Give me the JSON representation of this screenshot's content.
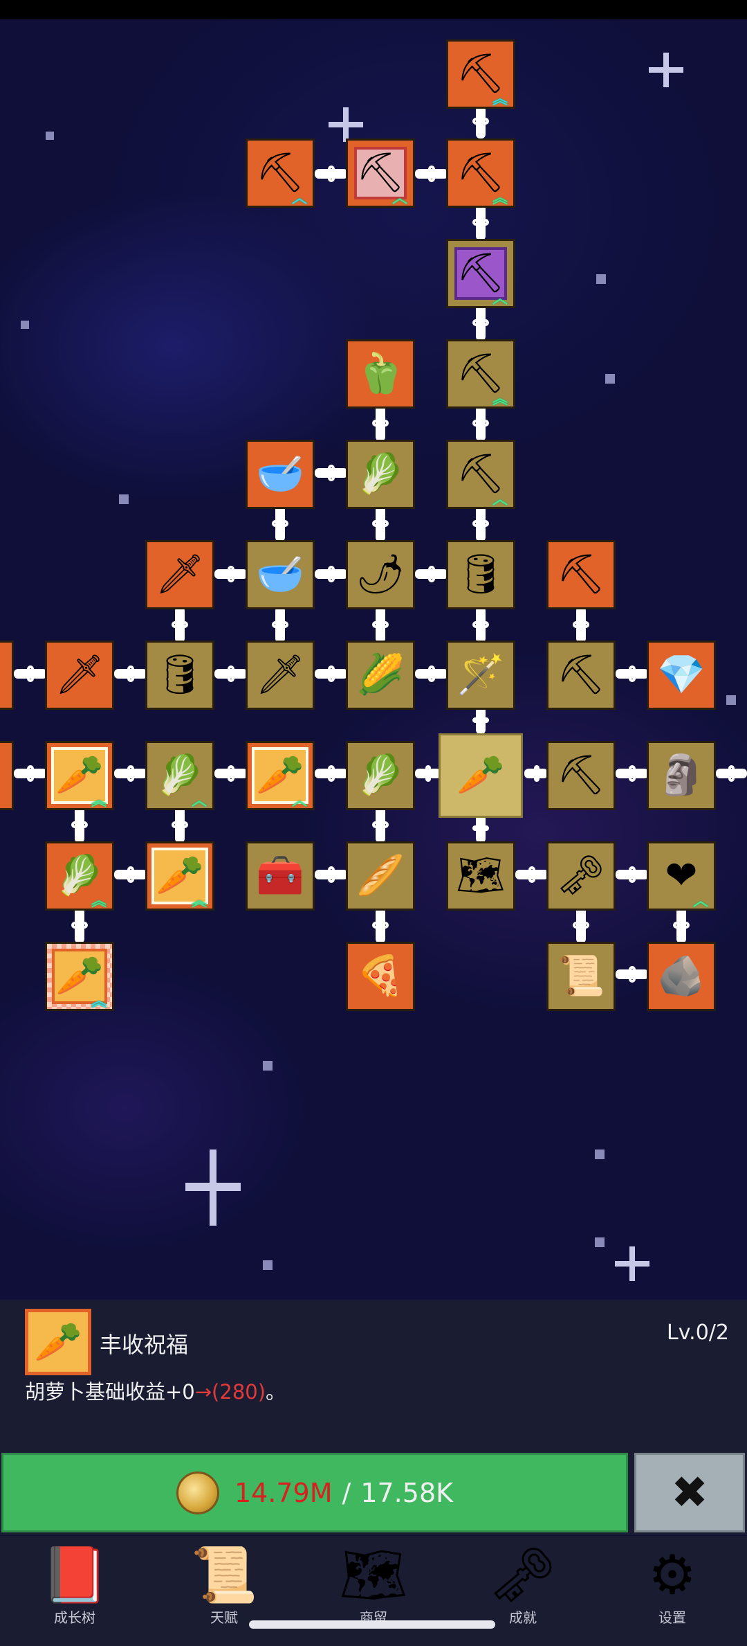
{
  "tree": {
    "nodes": [
      {
        "id": "n1",
        "icon": "shovel-icon",
        "glyph": "⛏",
        "style": "orange",
        "up": "blue"
      },
      {
        "id": "n2",
        "icon": "shovel-icon",
        "glyph": "⛏",
        "style": "orange",
        "up": "blue"
      },
      {
        "id": "n3",
        "icon": "shovel-icon",
        "glyph": "⛏",
        "style": "pinkbox",
        "up": "green"
      },
      {
        "id": "n4",
        "icon": "shovel-icon",
        "glyph": "⛏",
        "style": "orange",
        "up": "green"
      },
      {
        "id": "n5",
        "icon": "shovel-icon",
        "glyph": "⛏",
        "style": "purple",
        "up": "green"
      },
      {
        "id": "n6",
        "icon": "pepper-icon",
        "glyph": "🫑",
        "style": "orange",
        "up": ""
      },
      {
        "id": "n7",
        "icon": "shovel-icon",
        "glyph": "⛏",
        "style": "gold",
        "up": "green"
      },
      {
        "id": "n8",
        "icon": "bowl-icon",
        "glyph": "🥣",
        "style": "orange",
        "up": ""
      },
      {
        "id": "n9",
        "icon": "radish-icon",
        "glyph": "🥕",
        "style": "gold",
        "up": ""
      },
      {
        "id": "n10",
        "icon": "shovel-icon",
        "glyph": "⛏",
        "style": "gold",
        "up": "green"
      },
      {
        "id": "n11",
        "icon": "sword-icon",
        "glyph": "🗡",
        "style": "orange",
        "up": ""
      },
      {
        "id": "n12",
        "icon": "bowl-icon",
        "glyph": "🥣",
        "style": "gold",
        "up": ""
      },
      {
        "id": "n13",
        "icon": "chili-icon",
        "glyph": "🌶",
        "style": "gold",
        "up": ""
      },
      {
        "id": "n14",
        "icon": "barrel-icon",
        "glyph": "🛢",
        "style": "gold",
        "up": ""
      },
      {
        "id": "n15",
        "icon": "pickaxe-icon",
        "glyph": "⛏",
        "style": "orange",
        "up": ""
      }
    ]
  },
  "selected_skill": {
    "name": "丰收祝福",
    "level": "Lv.0/2",
    "desc_prefix": "胡萝卜基础收益+0",
    "desc_arrow": "→(280)",
    "desc_suffix": "。",
    "icon": "carrot-icon"
  },
  "purchase": {
    "have": "14.79M",
    "separator": "/",
    "need": "17.58K",
    "close_label": "✖"
  },
  "nav": [
    {
      "label": "成长树",
      "icon": "book-icon",
      "glyph": "📕"
    },
    {
      "label": "天赋",
      "icon": "scroll-icon",
      "glyph": "📜"
    },
    {
      "label": "商留",
      "icon": "map-icon",
      "glyph": "🗺"
    },
    {
      "label": "成就",
      "icon": "key-icon",
      "glyph": "🗝"
    },
    {
      "label": "设置",
      "icon": "gear-icon",
      "glyph": "⚙"
    }
  ]
}
